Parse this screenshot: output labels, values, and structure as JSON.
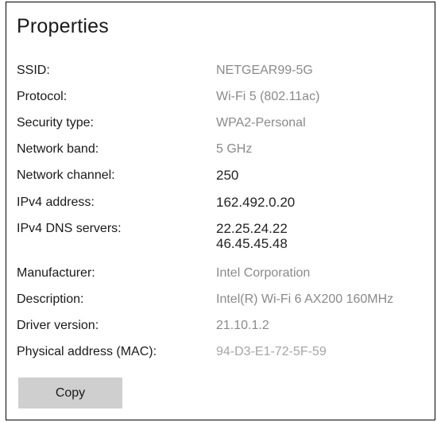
{
  "panel": {
    "title": "Properties"
  },
  "properties": [
    {
      "label": "SSID:",
      "value": "NETGEAR99-5G"
    },
    {
      "label": "Protocol:",
      "value": "Wi-Fi 5 (802.11ac)"
    },
    {
      "label": "Security type:",
      "value": "WPA2-Personal"
    },
    {
      "label": "Network band:",
      "value": "5 GHz"
    },
    {
      "label": "Network channel:",
      "value": "250"
    },
    {
      "label": "IPv4 address:",
      "value": "162.492.0.20"
    },
    {
      "label": "IPv4 DNS servers:",
      "values": [
        "22.25.24.22",
        "46.45.45.48"
      ]
    },
    {
      "label": "Manufacturer:",
      "value": "Intel Corporation"
    },
    {
      "label": "Description:",
      "value": "Intel(R) Wi-Fi 6 AX200 160MHz"
    },
    {
      "label": "Driver version:",
      "value": "21.10.1.2"
    },
    {
      "label": "Physical address (MAC):",
      "value": "94-D3-E1-72-5F-59"
    }
  ],
  "actions": {
    "copy_label": "Copy"
  }
}
